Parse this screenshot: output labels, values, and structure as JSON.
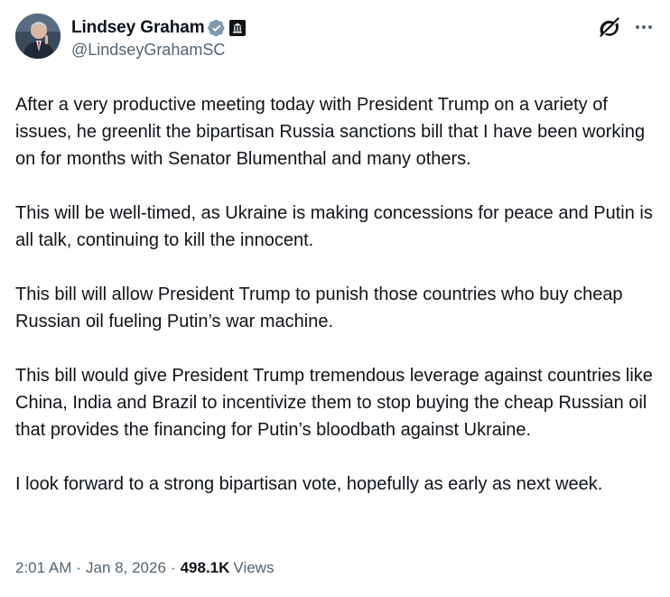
{
  "author": {
    "display_name": "Lindsey Graham",
    "handle": "@LindseyGrahamSC",
    "verified_icon": "verified-badge-gray",
    "affiliation_icon": "government-building-icon"
  },
  "actions": {
    "grok_icon": "grok-icon",
    "more_icon": "more-icon"
  },
  "body": {
    "paragraphs": [
      "After a very productive meeting today with President Trump on a variety of issues, he greenlit the bipartisan Russia sanctions bill that I have been working on for months with Senator Blumenthal and many others.",
      "This will be well-timed, as Ukraine is making concessions for peace and Putin is all talk, continuing to kill the innocent.",
      "This bill will allow President Trump to punish those countries who buy cheap Russian oil fueling Putin’s war machine.",
      "This bill would give President Trump tremendous leverage against countries like China, India and Brazil to incentivize them to stop buying the cheap Russian oil that provides the financing for Putin’s bloodbath against Ukraine.",
      "I look forward to a strong bipartisan vote, hopefully as early as next week."
    ]
  },
  "meta": {
    "time": "2:01 AM",
    "separator": "·",
    "date": "Jan 8, 2026",
    "views_count": "498.1K",
    "views_label": "Views"
  },
  "colors": {
    "text_primary": "#0f1419",
    "text_secondary": "#536471",
    "verified_badge": "#829aab"
  }
}
